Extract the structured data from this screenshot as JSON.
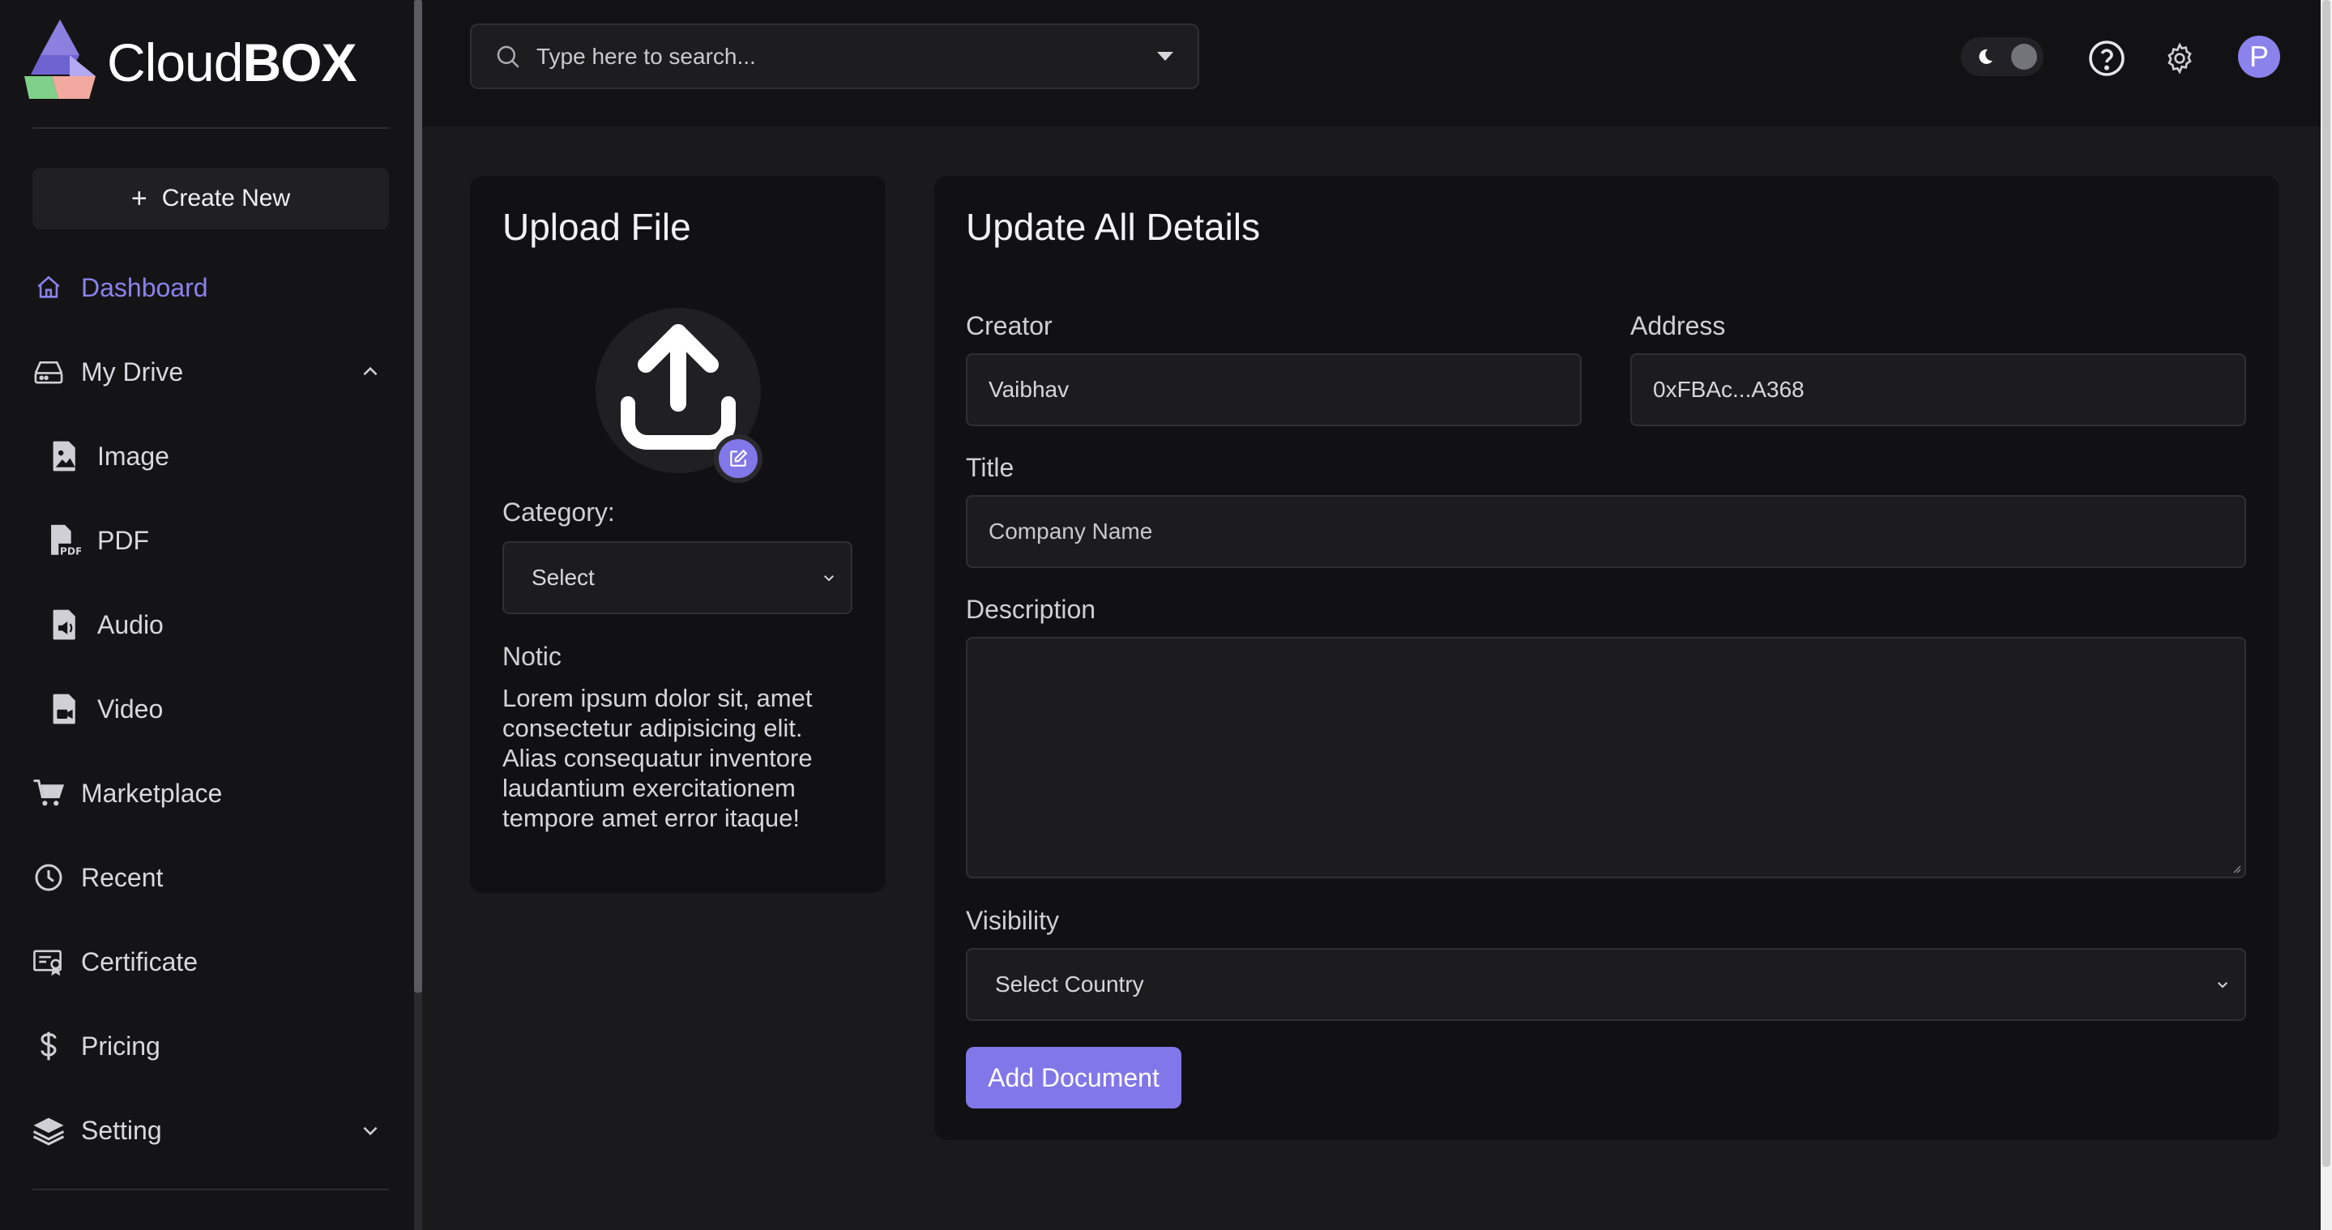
{
  "brand": {
    "name_light": "Cloud",
    "name_bold": "BOX"
  },
  "sidebar": {
    "create_label": "Create New",
    "items": [
      {
        "label": "Dashboard",
        "icon": "home-icon",
        "active": true
      },
      {
        "label": "My Drive",
        "icon": "drive-icon",
        "expanded": true
      },
      {
        "label": "Image",
        "icon": "image-file-icon"
      },
      {
        "label": "PDF",
        "icon": "pdf-file-icon"
      },
      {
        "label": "Audio",
        "icon": "audio-file-icon"
      },
      {
        "label": "Video",
        "icon": "video-file-icon"
      },
      {
        "label": "Marketplace",
        "icon": "cart-icon"
      },
      {
        "label": "Recent",
        "icon": "clock-icon"
      },
      {
        "label": "Certificate",
        "icon": "certificate-icon"
      },
      {
        "label": "Pricing",
        "icon": "dollar-icon"
      },
      {
        "label": "Setting",
        "icon": "layers-icon",
        "expanded": false
      }
    ]
  },
  "header": {
    "search_placeholder": "Type here to search...",
    "avatar_letter": "P"
  },
  "upload": {
    "title": "Upload File",
    "category_label": "Category:",
    "category_value": "Select",
    "notice_title": "Notic",
    "notice_text": "Lorem ipsum dolor sit, amet consectetur adipisicing elit. Alias consequatur inventore laudantium exercitationem tempore amet error itaque!"
  },
  "details": {
    "title": "Update All Details",
    "creator_label": "Creator",
    "creator_value": "Vaibhav",
    "address_label": "Address",
    "address_value": "0xFBAc...A368",
    "title_label": "Title",
    "title_placeholder": "Company Name",
    "description_label": "Description",
    "visibility_label": "Visibility",
    "visibility_value": "Select Country",
    "submit_label": "Add Document"
  },
  "colors": {
    "accent": "#8177e8",
    "active_nav": "#8b82ec",
    "background": "#1a1a1c",
    "card": "#111113"
  }
}
